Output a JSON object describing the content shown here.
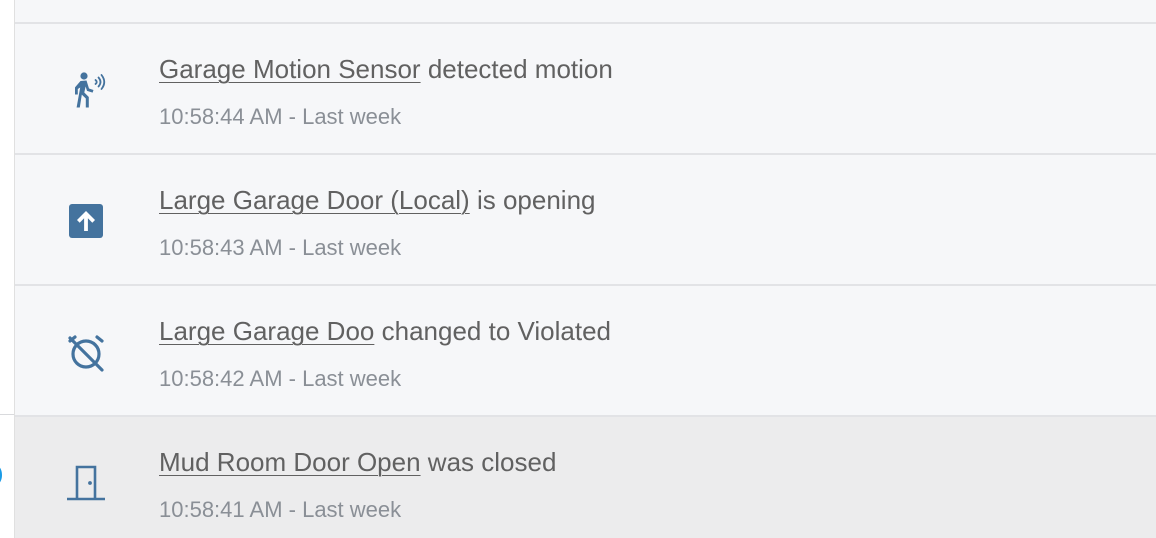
{
  "logbook": {
    "entries": [
      {
        "icon": "motion-sensor-icon",
        "entity": "Garage Motion Sensor",
        "message": "detected motion",
        "time": "10:58:44 AM - Last week"
      },
      {
        "icon": "arrow-up-box-icon",
        "entity": "Large Garage Door (Local)",
        "message": "is opening",
        "time": "10:58:43 AM - Last week"
      },
      {
        "icon": "alarm-off-icon",
        "entity": "Large Garage Doo",
        "message": "changed to Violated",
        "time": "10:58:42 AM - Last week"
      },
      {
        "icon": "door-closed-icon",
        "entity": "Mud Room Door Open",
        "message": "was closed",
        "time": "10:58:41 AM - Last week"
      }
    ]
  },
  "colors": {
    "icon": "#44739e",
    "text": "#616161",
    "secondary_text": "#8a8f96",
    "row_background": "#f6f7f9",
    "hover_background": "#ececed",
    "divider": "#e2e3e6",
    "accent": "#1a9be6"
  }
}
